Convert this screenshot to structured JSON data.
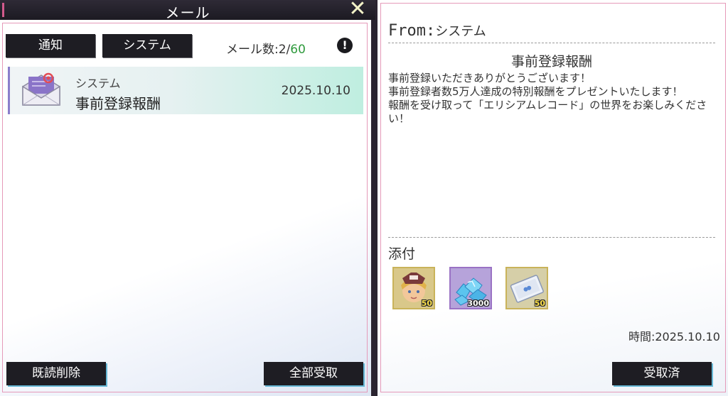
{
  "window": {
    "title": "メール",
    "close_icon": "close-x-icon"
  },
  "tabs": [
    {
      "label": "通知"
    },
    {
      "label": "システム"
    }
  ],
  "mail_count": {
    "label": "メール数:",
    "current": "2",
    "separator": "/",
    "max": "60"
  },
  "info_icon": "!",
  "mail_list": [
    {
      "icon": "envelope-icon",
      "sender": "システム",
      "subject": "事前登録報酬",
      "date": "2025.10.10"
    }
  ],
  "footer": {
    "delete_read": "既読削除",
    "receive_all": "全部受取"
  },
  "detail": {
    "from_label": "From:",
    "from_value": "システム",
    "title": "事前登録報酬",
    "body": [
      "事前登録いただきありがとうございます！",
      "事前登録者数5万人達成の特別報酬をプレゼントいたします！",
      "報酬を受け取って「エリシアムレコード」の世界をお楽しみください！"
    ],
    "attachments_label": "添付",
    "attachments": [
      {
        "icon": "character-portrait-icon",
        "quantity": "50"
      },
      {
        "icon": "blue-crystals-icon",
        "quantity": "3000"
      },
      {
        "icon": "ticket-icon",
        "quantity": "50"
      }
    ],
    "time": "時間:2025.10.10",
    "received_button": "受取済"
  },
  "colors": {
    "accent_pink": "#e59ab9",
    "count_green": "#2f9a3d",
    "button_dark": "#1e1d23",
    "quantity_yellow": "#ffe34d"
  }
}
